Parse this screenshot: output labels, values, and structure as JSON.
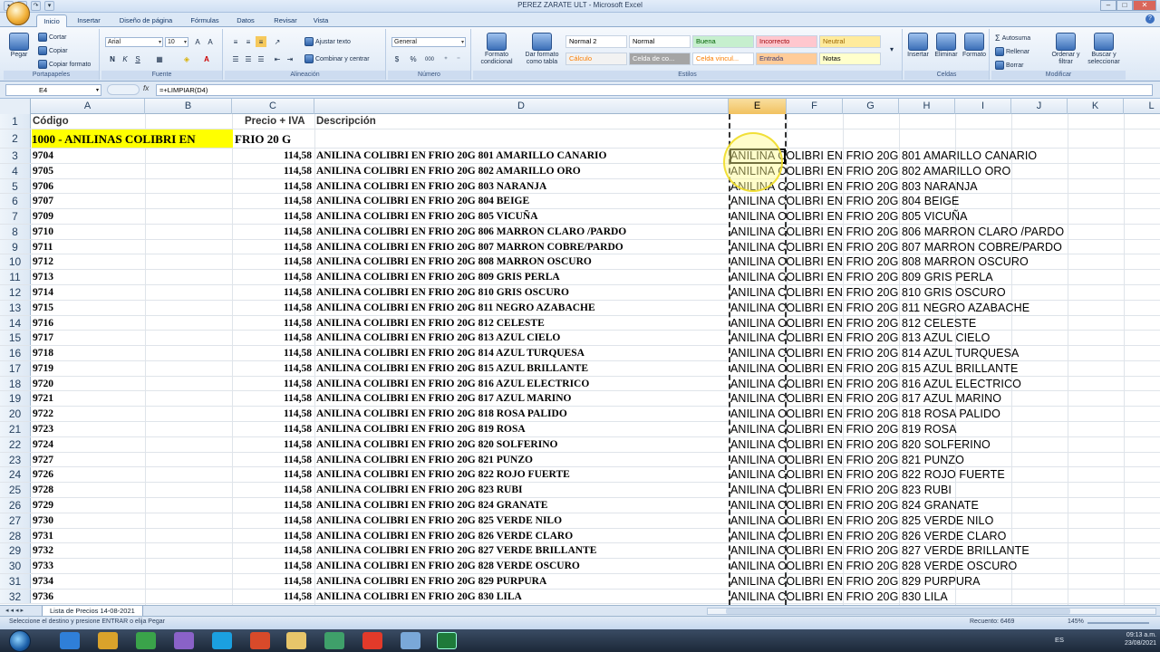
{
  "window": {
    "title": "PEREZ ZARATE ULT  -  Microsoft Excel"
  },
  "tabs": [
    "Inicio",
    "Insertar",
    "Diseño de página",
    "Fórmulas",
    "Datos",
    "Revisar",
    "Vista"
  ],
  "ribbon": {
    "clipboard": {
      "paste": "Pegar",
      "cut": "Cortar",
      "copy": "Copiar",
      "format_painter": "Copiar formato",
      "label": "Portapapeles"
    },
    "font": {
      "name": "Arial",
      "size": "10",
      "label": "Fuente",
      "bold": "N",
      "italic": "K",
      "underline": "S"
    },
    "alignment": {
      "wrap": "Ajustar texto",
      "merge": "Combinar y centrar",
      "label": "Alineación"
    },
    "number": {
      "format": "General",
      "currency": "$",
      "percent": "%",
      "thousands": "000",
      "label": "Número"
    },
    "styles": {
      "cond_format": "Formato condicional",
      "as_table": "Dar formato como tabla",
      "cells": [
        {
          "text": "Normal 2",
          "bg": "#ffffff",
          "fg": "#000000"
        },
        {
          "text": "Normal",
          "bg": "#ffffff",
          "fg": "#000000"
        },
        {
          "text": "Buena",
          "bg": "#c6efce",
          "fg": "#006100"
        },
        {
          "text": "Incorrecto",
          "bg": "#ffc7ce",
          "fg": "#9c0006"
        },
        {
          "text": "Neutral",
          "bg": "#ffeb9c",
          "fg": "#9c6500"
        },
        {
          "text": "Cálculo",
          "bg": "#f2f2f2",
          "fg": "#fa7d00"
        },
        {
          "text": "Celda de co...",
          "bg": "#a5a5a5",
          "fg": "#ffffff"
        },
        {
          "text": "Celda vincul...",
          "bg": "#ffffff",
          "fg": "#fa7d00"
        },
        {
          "text": "Entrada",
          "bg": "#ffcc99",
          "fg": "#3f3f76"
        },
        {
          "text": "Notas",
          "bg": "#ffffcc",
          "fg": "#000000"
        }
      ],
      "label": "Estilos"
    },
    "cells": {
      "insert": "Insertar",
      "delete": "Eliminar",
      "format": "Formato",
      "label": "Celdas"
    },
    "editing": {
      "autosum": "Autosuma",
      "fill": "Rellenar",
      "clear": "Borrar",
      "sort": "Ordenar y filtrar",
      "find": "Buscar y seleccionar",
      "label": "Modificar"
    }
  },
  "formula_bar": {
    "name_box": "E4",
    "fx": "fx",
    "formula": "=+LIMPIAR(D4)"
  },
  "columns": [
    "A",
    "B",
    "C",
    "D",
    "E",
    "F",
    "G",
    "H",
    "I",
    "J",
    "K",
    "L"
  ],
  "header_row": {
    "num": "1",
    "codigo": "Código",
    "precio": "Precio +  IVA",
    "descripcion": "Descripción"
  },
  "group_row": {
    "num": "2",
    "text": "1000 - ANILINAS COLIBRI EN",
    "text2": "FRIO 20 G"
  },
  "rows": [
    {
      "num": "3",
      "code": "9704",
      "price": "114,58",
      "desc": "ANILINA COLIBRI EN FRIO 20G 801 AMARILLO CANARIO",
      "clean": "ANILINA COLIBRI EN FRIO 20G 801 AMARILLO CANARIO"
    },
    {
      "num": "4",
      "code": "9705",
      "price": "114,58",
      "desc": "ANILINA COLIBRI EN FRIO 20G 802 AMARILLO ORO",
      "clean": "ANILINA COLIBRI EN FRIO 20G 802 AMARILLO ORO"
    },
    {
      "num": "5",
      "code": "9706",
      "price": "114,58",
      "desc": "ANILINA COLIBRI EN FRIO 20G 803 NARANJA",
      "clean": "ANILINA COLIBRI EN FRIO 20G 803 NARANJA"
    },
    {
      "num": "6",
      "code": "9707",
      "price": "114,58",
      "desc": "ANILINA COLIBRI EN FRIO 20G 804 BEIGE",
      "clean": "ANILINA COLIBRI EN FRIO 20G 804 BEIGE"
    },
    {
      "num": "7",
      "code": "9709",
      "price": "114,58",
      "desc": "ANILINA COLIBRI EN FRIO 20G 805 VICUÑA",
      "clean": "ANILINA COLIBRI EN FRIO 20G 805 VICUÑA"
    },
    {
      "num": "8",
      "code": "9710",
      "price": "114,58",
      "desc": "ANILINA COLIBRI EN FRIO 20G 806 MARRON CLARO /PARDO",
      "clean": "ANILINA COLIBRI EN FRIO 20G 806 MARRON CLARO /PARDO"
    },
    {
      "num": "9",
      "code": "9711",
      "price": "114,58",
      "desc": "ANILINA COLIBRI EN FRIO 20G 807 MARRON COBRE/PARDO",
      "clean": "ANILINA COLIBRI EN FRIO 20G 807 MARRON COBRE/PARDO"
    },
    {
      "num": "10",
      "code": "9712",
      "price": "114,58",
      "desc": "ANILINA COLIBRI EN FRIO 20G 808 MARRON OSCURO",
      "clean": "ANILINA COLIBRI EN FRIO 20G 808 MARRON OSCURO"
    },
    {
      "num": "11",
      "code": "9713",
      "price": "114,58",
      "desc": "ANILINA COLIBRI EN FRIO 20G 809 GRIS PERLA",
      "clean": "ANILINA COLIBRI EN FRIO 20G 809 GRIS PERLA"
    },
    {
      "num": "12",
      "code": "9714",
      "price": "114,58",
      "desc": "ANILINA COLIBRI EN FRIO 20G 810 GRIS OSCURO",
      "clean": "ANILINA COLIBRI EN FRIO 20G 810 GRIS OSCURO"
    },
    {
      "num": "13",
      "code": "9715",
      "price": "114,58",
      "desc": "ANILINA COLIBRI EN FRIO 20G 811 NEGRO AZABACHE",
      "clean": "ANILINA COLIBRI EN FRIO 20G 811 NEGRO AZABACHE"
    },
    {
      "num": "14",
      "code": "9716",
      "price": "114,58",
      "desc": "ANILINA COLIBRI EN FRIO 20G 812 CELESTE",
      "clean": "ANILINA COLIBRI EN FRIO 20G 812 CELESTE"
    },
    {
      "num": "15",
      "code": "9717",
      "price": "114,58",
      "desc": "ANILINA COLIBRI EN FRIO 20G 813 AZUL CIELO",
      "clean": "ANILINA COLIBRI EN FRIO 20G 813 AZUL CIELO"
    },
    {
      "num": "16",
      "code": "9718",
      "price": "114,58",
      "desc": "ANILINA COLIBRI EN FRIO 20G 814 AZUL TURQUESA",
      "clean": "ANILINA COLIBRI EN FRIO 20G 814 AZUL TURQUESA"
    },
    {
      "num": "17",
      "code": "9719",
      "price": "114,58",
      "desc": "ANILINA COLIBRI EN FRIO 20G 815 AZUL BRILLANTE",
      "clean": "ANILINA COLIBRI EN FRIO 20G 815 AZUL BRILLANTE"
    },
    {
      "num": "18",
      "code": "9720",
      "price": "114,58",
      "desc": "ANILINA COLIBRI EN FRIO 20G 816 AZUL ELECTRICO",
      "clean": "ANILINA COLIBRI EN FRIO 20G 816 AZUL ELECTRICO"
    },
    {
      "num": "19",
      "code": "9721",
      "price": "114,58",
      "desc": "ANILINA COLIBRI EN FRIO 20G 817 AZUL MARINO",
      "clean": "ANILINA COLIBRI EN FRIO 20G 817 AZUL MARINO"
    },
    {
      "num": "20",
      "code": "9722",
      "price": "114,58",
      "desc": "ANILINA COLIBRI EN FRIO 20G 818 ROSA PALIDO",
      "clean": "ANILINA COLIBRI EN FRIO 20G 818 ROSA PALIDO"
    },
    {
      "num": "21",
      "code": "9723",
      "price": "114,58",
      "desc": "ANILINA COLIBRI EN FRIO 20G 819 ROSA",
      "clean": "ANILINA COLIBRI EN FRIO 20G 819 ROSA"
    },
    {
      "num": "22",
      "code": "9724",
      "price": "114,58",
      "desc": "ANILINA COLIBRI EN FRIO 20G 820 SOLFERINO",
      "clean": "ANILINA COLIBRI EN FRIO 20G 820 SOLFERINO"
    },
    {
      "num": "23",
      "code": "9727",
      "price": "114,58",
      "desc": "ANILINA COLIBRI EN FRIO 20G 821 PUNZO",
      "clean": "ANILINA COLIBRI EN FRIO 20G 821 PUNZO"
    },
    {
      "num": "24",
      "code": "9726",
      "price": "114,58",
      "desc": "ANILINA COLIBRI EN FRIO 20G 822 ROJO FUERTE",
      "clean": "ANILINA COLIBRI EN FRIO 20G 822 ROJO FUERTE"
    },
    {
      "num": "25",
      "code": "9728",
      "price": "114,58",
      "desc": "ANILINA COLIBRI EN FRIO 20G 823 RUBI",
      "clean": "ANILINA COLIBRI EN FRIO 20G 823 RUBI"
    },
    {
      "num": "26",
      "code": "9729",
      "price": "114,58",
      "desc": "ANILINA COLIBRI EN FRIO 20G 824 GRANATE",
      "clean": "ANILINA COLIBRI EN FRIO 20G 824 GRANATE"
    },
    {
      "num": "27",
      "code": "9730",
      "price": "114,58",
      "desc": "ANILINA COLIBRI EN FRIO 20G 825 VERDE NILO",
      "clean": "ANILINA COLIBRI EN FRIO 20G 825 VERDE NILO"
    },
    {
      "num": "28",
      "code": "9731",
      "price": "114,58",
      "desc": "ANILINA COLIBRI EN FRIO 20G 826 VERDE CLARO",
      "clean": "ANILINA COLIBRI EN FRIO 20G 826 VERDE CLARO"
    },
    {
      "num": "29",
      "code": "9732",
      "price": "114,58",
      "desc": "ANILINA COLIBRI EN FRIO 20G 827 VERDE BRILLANTE",
      "clean": "ANILINA COLIBRI EN FRIO 20G 827 VERDE BRILLANTE"
    },
    {
      "num": "30",
      "code": "9733",
      "price": "114,58",
      "desc": "ANILINA COLIBRI EN FRIO 20G 828 VERDE OSCURO",
      "clean": "ANILINA COLIBRI EN FRIO 20G 828 VERDE OSCURO"
    },
    {
      "num": "31",
      "code": "9734",
      "price": "114,58",
      "desc": "ANILINA COLIBRI EN FRIO 20G 829 PURPURA",
      "clean": "ANILINA COLIBRI EN FRIO 20G 829 PURPURA"
    },
    {
      "num": "32",
      "code": "9736",
      "price": "114,58",
      "desc": "ANILINA COLIBRI EN FRIO 20G 830 LILA",
      "clean": "ANILINA COLIBRI EN FRIO 20G 830 LILA"
    }
  ],
  "sheet_tab": "Lista de Precios 14-08-2021",
  "status": {
    "message": "Seleccione el destino y presione ENTRAR o elija Pegar",
    "count": "Recuento: 6469",
    "zoom": "145%"
  },
  "taskbar": {
    "lang": "ES",
    "time": "09:13 a.m.",
    "date": "23/08/2021"
  },
  "colors": {
    "group_highlight": "#ffff00",
    "selected_col": "#f1c15f"
  }
}
